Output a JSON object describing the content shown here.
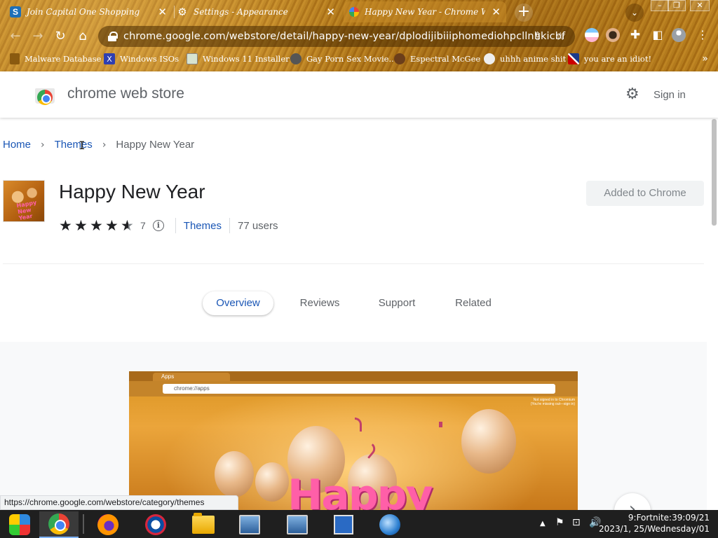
{
  "browser": {
    "tabs": [
      {
        "title": "Join Capital One Shopping",
        "favicon": "capital-one-shopping-icon"
      },
      {
        "title": "Settings - Appearance",
        "favicon": "gear-icon"
      },
      {
        "title": "Happy New Year - Chrome Web S",
        "favicon": "chrome-web-store-icon"
      }
    ],
    "url": "chrome.google.com/webstore/detail/happy-new-year/dplodijibiiiphomediohpcllnhkicbf",
    "bookmarks": [
      {
        "label": "Malware Database",
        "icon": "malware-icon"
      },
      {
        "label": "Windows ISOs",
        "icon": "x-icon"
      },
      {
        "label": "Windows 11 Installer",
        "icon": "image-icon"
      },
      {
        "label": "Gay Porn Sex Movie...",
        "icon": "site-icon"
      },
      {
        "label": "Espectral McGee",
        "icon": "mask-icon"
      },
      {
        "label": "uhhh anime shit",
        "icon": "anime-icon"
      },
      {
        "label": "you are an idiot!",
        "icon": "flag-icon"
      }
    ],
    "bookmarks_more": "»"
  },
  "store": {
    "title": "chrome web store",
    "signin": "Sign in"
  },
  "breadcrumb": {
    "home": "Home",
    "category": "Themes",
    "current": "Happy New Year"
  },
  "item": {
    "title": "Happy New Year",
    "thumb_text": "Happy New Year",
    "rating": 4.5,
    "rating_count": "7",
    "category": "Themes",
    "users": "77 users",
    "action_button": "Added to Chrome"
  },
  "content_tabs": [
    "Overview",
    "Reviews",
    "Support",
    "Related"
  ],
  "active_tab": "Overview",
  "screenshot": {
    "tab_title": "Apps",
    "url": "chrome://apps",
    "note": "Not signed in to Chromium (You're missing out—sign in)",
    "headline": "Happy"
  },
  "status_url": "https://chrome.google.com/webstore/category/themes",
  "taskbar": {
    "apps": [
      "multicolor-app-icon",
      "chrome-icon",
      "firefox-icon",
      "obama-logo-icon",
      "file-explorer-icon",
      "computer-icon",
      "network-computer-icon",
      "calendar-clock-icon",
      "globe-icon"
    ],
    "clock_line1": "9:Fortnite:39:09/21",
    "clock_line2": "2023/1, 25/Wednesday/01"
  },
  "colors": {
    "link": "#1a56b5",
    "theme_gold": "#b07a1c",
    "taskbar": "#1f1f1f"
  }
}
